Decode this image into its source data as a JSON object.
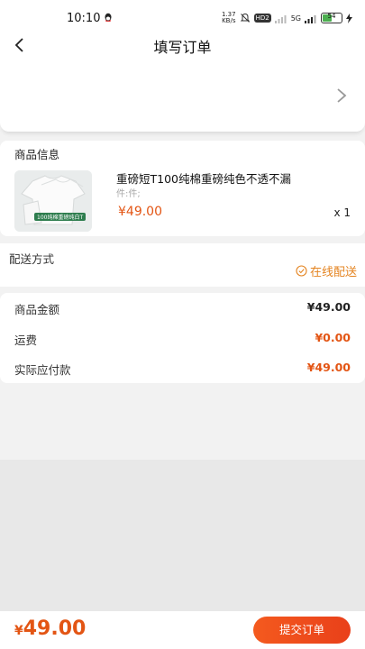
{
  "status_bar": {
    "time": "10:10",
    "network_speed_value": "1.37",
    "network_speed_unit": "KB/s",
    "hd_badge": "HD2",
    "signal_label": "5G",
    "battery": "54",
    "battery_level": 0.54
  },
  "nav": {
    "title": "填写订单"
  },
  "goods": {
    "section_title": "商品信息",
    "name": "重磅短T100纯棉重磅纯色不透不漏",
    "spec": "件:件;",
    "price": "¥49.00",
    "quantity": "x 1",
    "thumb_caption": "100纯棉重磅纯白T"
  },
  "delivery": {
    "title": "配送方式",
    "option": "在线配送"
  },
  "summary": {
    "rows": [
      {
        "label": "商品金额",
        "value": "¥49.00",
        "color": "#222222"
      },
      {
        "label": "运费",
        "value": "¥0.00",
        "color": "#e35514"
      },
      {
        "label": "实际应付款",
        "value": "¥49.00",
        "color": "#e35514"
      }
    ]
  },
  "footer": {
    "currency": "¥",
    "total": "49.00",
    "submit_label": "提交订单"
  },
  "colors": {
    "accent": "#e35514",
    "delivery": "#e4831f",
    "background": "#f2f2f2"
  }
}
